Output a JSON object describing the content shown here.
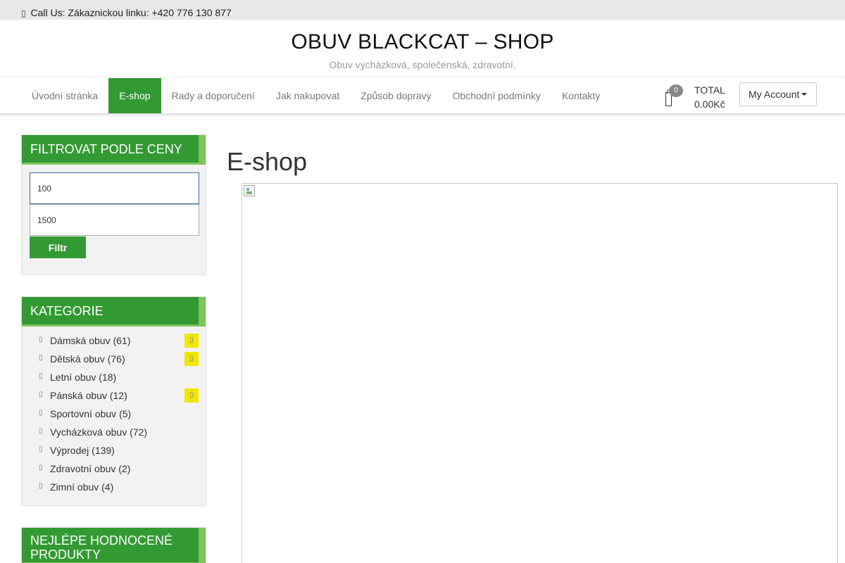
{
  "topbar": {
    "call_text": "Call Us: Zákaznickou linku: +420 776 130 877",
    "phone_icon": "▯"
  },
  "brand": {
    "title": "OBUV BLACKCAT – SHOP",
    "tagline": "Obuv vycházková, společenská, zdravotní."
  },
  "nav": {
    "items": [
      {
        "label": "Úvodní stránka",
        "active": false
      },
      {
        "label": "E-shop",
        "active": true
      },
      {
        "label": "Rady a doporučení",
        "active": false
      },
      {
        "label": "Jak nakupovat",
        "active": false
      },
      {
        "label": "Způsob dopravy",
        "active": false
      },
      {
        "label": "Obchodní podmínky",
        "active": false
      },
      {
        "label": "Kontakty",
        "active": false
      }
    ]
  },
  "cart": {
    "count": "0",
    "total_label": "TOTAL",
    "total_value": "0.00Kč"
  },
  "account": {
    "label": "My Account"
  },
  "price_filter": {
    "title": "FILTROVAT PODLE CENY",
    "min_value": "100",
    "max_value": "1500",
    "button_label": "Filtr"
  },
  "categories": {
    "title": "KATEGORIE",
    "items": [
      {
        "label": "Dámská obuv",
        "count": "(61)",
        "expandable": true
      },
      {
        "label": "Dětská obuv",
        "count": "(76)",
        "expandable": true
      },
      {
        "label": "Letní obuv",
        "count": "(18)",
        "expandable": false
      },
      {
        "label": "Pánská obuv",
        "count": "(12)",
        "expandable": true
      },
      {
        "label": "Sportovní obuv",
        "count": "(5)",
        "expandable": false
      },
      {
        "label": "Vycházková obuv",
        "count": "(72)",
        "expandable": false
      },
      {
        "label": "Výprodej",
        "count": "(139)",
        "expandable": false
      },
      {
        "label": "Zdravotní obuv",
        "count": "(2)",
        "expandable": false
      },
      {
        "label": "Zimní obuv",
        "count": "(4)",
        "expandable": false
      }
    ]
  },
  "top_rated": {
    "title_line1": "NEJLÉPE HODNOCENÉ",
    "title_line2": "PRODUKTY"
  },
  "main": {
    "title": "E-shop"
  },
  "colors": {
    "accent_green": "#339933",
    "light_green": "#7dc45a",
    "expand_yellow": "#f2e600"
  }
}
